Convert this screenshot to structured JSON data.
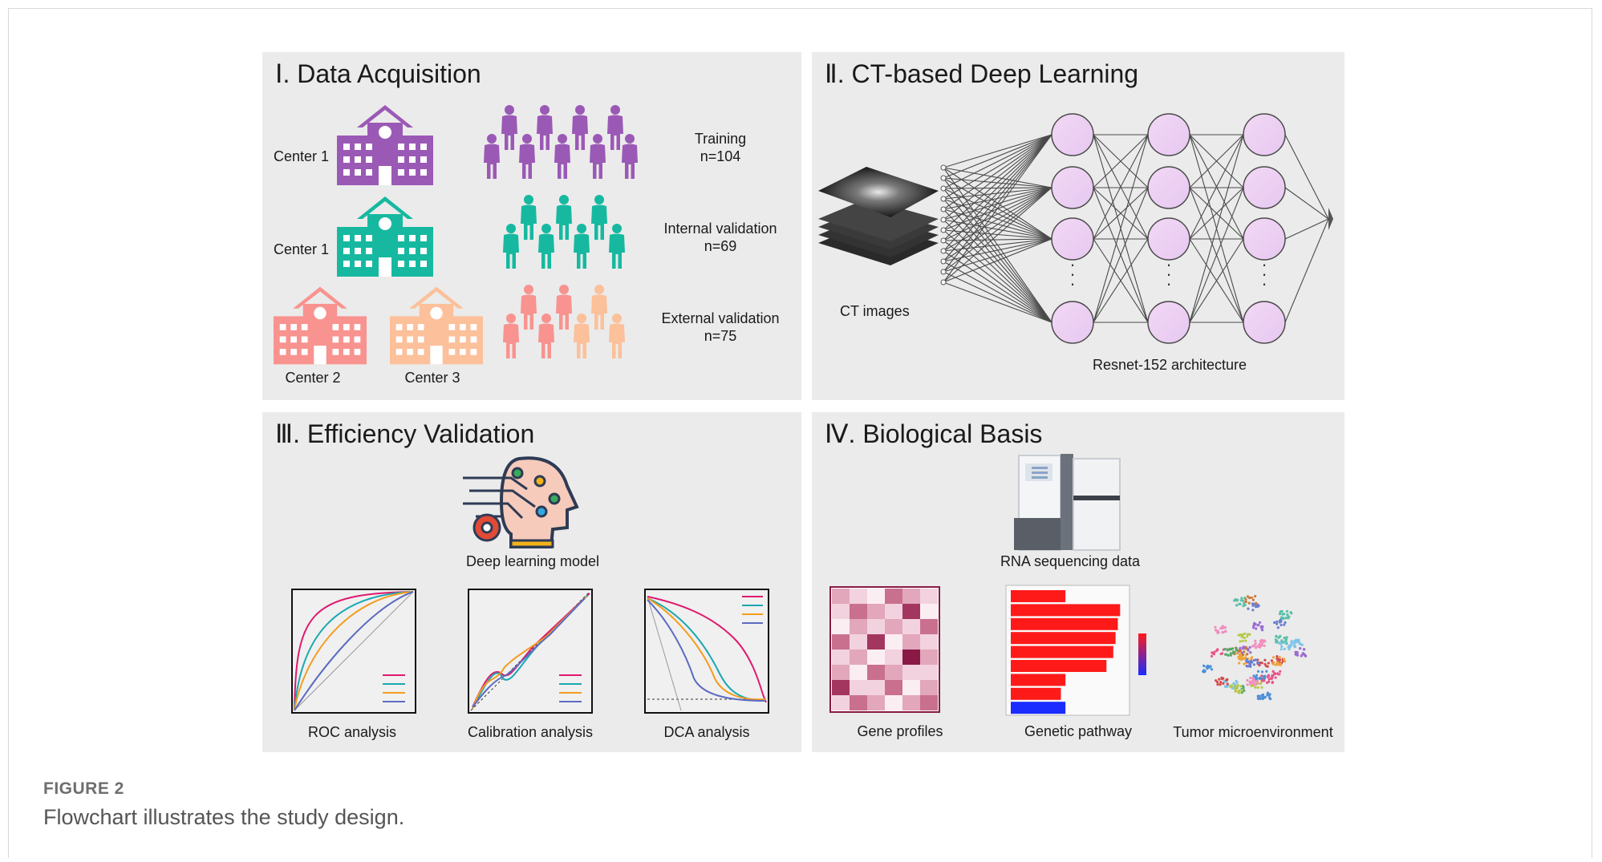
{
  "colors": {
    "panel_bg": "#ebebeb",
    "center1_training": "#9b59b6",
    "center1_internal": "#16b9a0",
    "center2": "#f8938f",
    "center3": "#fcc09a",
    "node_fill": "#e6c8f0",
    "curve_red": "#e0196e",
    "curve_teal": "#1aa8b0",
    "curve_orange": "#f39c1f",
    "curve_blue": "#5b6bc0",
    "bar_red": "#ff1a1a",
    "bar_blue": "#1a2cff"
  },
  "panel1": {
    "title": "Ⅰ. Data Acquisition",
    "center_a_label": "Center 1",
    "center_b_label": "Center 1",
    "center2_label": "Center 2",
    "center3_label": "Center 3",
    "training": {
      "name": "Training",
      "n": "n=104"
    },
    "internal": {
      "name": "Internal validation",
      "n": "n=69"
    },
    "external": {
      "name": "External validation",
      "n": "n=75"
    },
    "icons": {
      "hospital": "hospital-icon",
      "people": "people-group-icon"
    }
  },
  "panel2": {
    "title": "Ⅱ. CT-based Deep Learning",
    "ct_label": "CT images",
    "arch_label": "Resnet-152 architecture",
    "ellipsis": "·\n·\n·"
  },
  "panel3": {
    "title": "Ⅲ. Efficiency Validation",
    "model_label": "Deep learning model",
    "roc_label": "ROC analysis",
    "calib_label": "Calibration analysis",
    "dca_label": "DCA analysis",
    "icons": {
      "model": "ai-head-gear-icon"
    }
  },
  "panel4": {
    "title": "Ⅳ. Biological Basis",
    "rna_label": "RNA sequencing data",
    "gene_label": "Gene profiles",
    "pathway_label": "Genetic pathway",
    "tme_label": "Tumor microenvironment",
    "icons": {
      "sequencer": "sequencer-machine-icon"
    }
  },
  "figure": {
    "label": "FIGURE 2",
    "caption": "Flowchart illustrates the study design."
  }
}
